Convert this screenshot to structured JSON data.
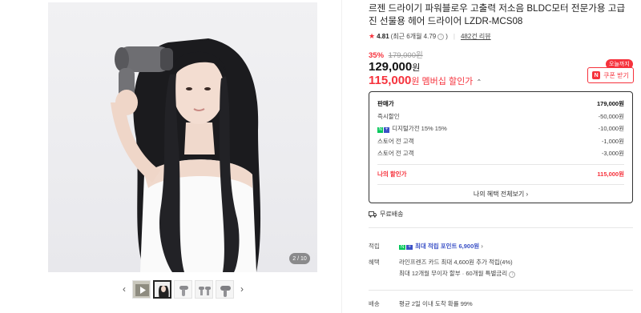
{
  "gallery": {
    "counter": "2 / 10",
    "prev_arrow": "‹",
    "next_arrow": "›"
  },
  "product": {
    "title": "르젠 드라이기 파워블로우 고출력 저소음 BLDC모터 전문가용 고급진 선물용 헤어 드라이어 LZDR-MCS08",
    "rating": "4.81",
    "rating_recent": "(최근 6개월 4.79",
    "rating_close": ")",
    "reviews": "482건 리뷰",
    "discount_rate": "35%",
    "original_price": "179,000원",
    "price": "129,000",
    "price_unit": "원",
    "member_price": "115,000",
    "member_price_unit": "원",
    "member_label": "멤버십 할인가",
    "member_chevron": "⌃"
  },
  "coupon": {
    "tag": "오늘까지",
    "button_icon": "N",
    "button_label": "쿠폰 받기"
  },
  "price_box": {
    "rows": [
      {
        "label": "판매가",
        "value": "179,000원"
      },
      {
        "label": "즉시할인",
        "value": "-50,000원"
      },
      {
        "label": "디지털가전 15% 15%",
        "value": "-10,000원"
      },
      {
        "label": "스토어 전 고객",
        "value": "-1,000원"
      },
      {
        "label": "스토어 전 고객",
        "value": "-3,000원"
      }
    ],
    "mine_label": "나의 할인가",
    "mine_value": "115,000원",
    "benefit_link": "나의 혜택 전체보기 ›"
  },
  "shipping": {
    "label": "무료배송"
  },
  "info": {
    "point_key": "적립",
    "point_value": "최대 적립 포인트 6,900원",
    "benefit_key": "혜택",
    "benefit_line1": "라인프렌즈 카드 최대 4,600원 추가 적립(4%)",
    "benefit_line2": "최대 12개월 무이자 할부 · 60개월 특별금리",
    "delivery_key": "배송",
    "delivery_line1": "평균 2일 이내 도착 확률 99%"
  },
  "colors": {
    "accent": "#f6323c",
    "naver_green": "#03c75a",
    "point_blue": "#3b51c6"
  }
}
